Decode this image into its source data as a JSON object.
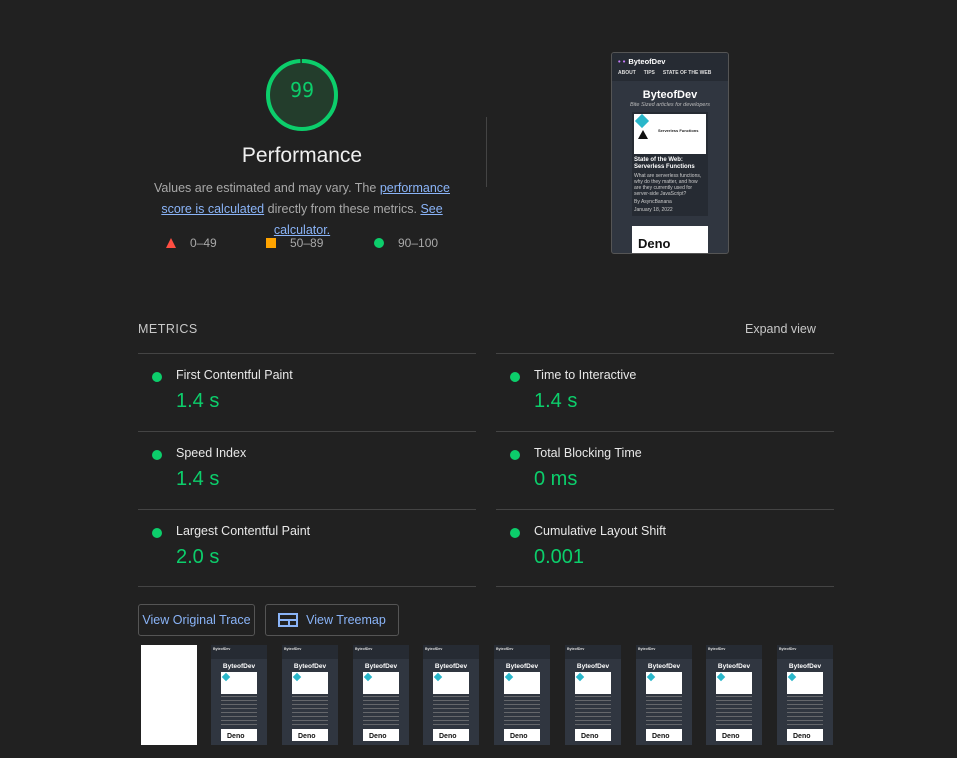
{
  "gauge": {
    "score": "99",
    "title": "Performance",
    "score_fraction": 0.99
  },
  "description": {
    "text1": "Values are estimated and may vary. The ",
    "link1": "performance score is calculated",
    "text2": " directly from these metrics. ",
    "link2": "See calculator."
  },
  "legend": [
    {
      "shape": "triangle",
      "range": "0–49",
      "color": "#ff4e42"
    },
    {
      "shape": "square",
      "range": "50–89",
      "color": "#ffa400"
    },
    {
      "shape": "circle",
      "range": "90–100",
      "color": "#0cce6b"
    }
  ],
  "preview": {
    "brand": "ByteofDev",
    "nav": [
      "ABOUT",
      "TIPS",
      "STATE OF THE WEB"
    ],
    "heading": "ByteofDev",
    "subtitle": "Bite Sized articles for developers",
    "image_text": "Serverless Functions",
    "card_title": "State of the Web: Serverless Functions",
    "card_desc": "What are serverless functions, why do they matter, and how are they currently used for server-side JavaScript?",
    "card_author": "By AsyncBanana",
    "card_date": "January 18, 2022",
    "card2_text": "Deno"
  },
  "metrics": {
    "label": "METRICS",
    "expand": "Expand view",
    "items": [
      {
        "name": "First Contentful Paint",
        "value": "1.4 s"
      },
      {
        "name": "Time to Interactive",
        "value": "1.4 s"
      },
      {
        "name": "Speed Index",
        "value": "1.4 s"
      },
      {
        "name": "Total Blocking Time",
        "value": "0 ms"
      },
      {
        "name": "Largest Contentful Paint",
        "value": "2.0 s"
      },
      {
        "name": "Cumulative Layout Shift",
        "value": "0.001"
      }
    ]
  },
  "buttons": {
    "original_trace": "View Original Trace",
    "treemap": "View Treemap"
  },
  "filmstrip": {
    "brand": "ByteofDev",
    "heading": "ByteofDev",
    "card2_text": "Deno"
  },
  "colors": {
    "pass": "#0cce6b",
    "average": "#ffa400",
    "fail": "#ff4e42",
    "link": "#8ab4f8",
    "background": "#212121"
  }
}
